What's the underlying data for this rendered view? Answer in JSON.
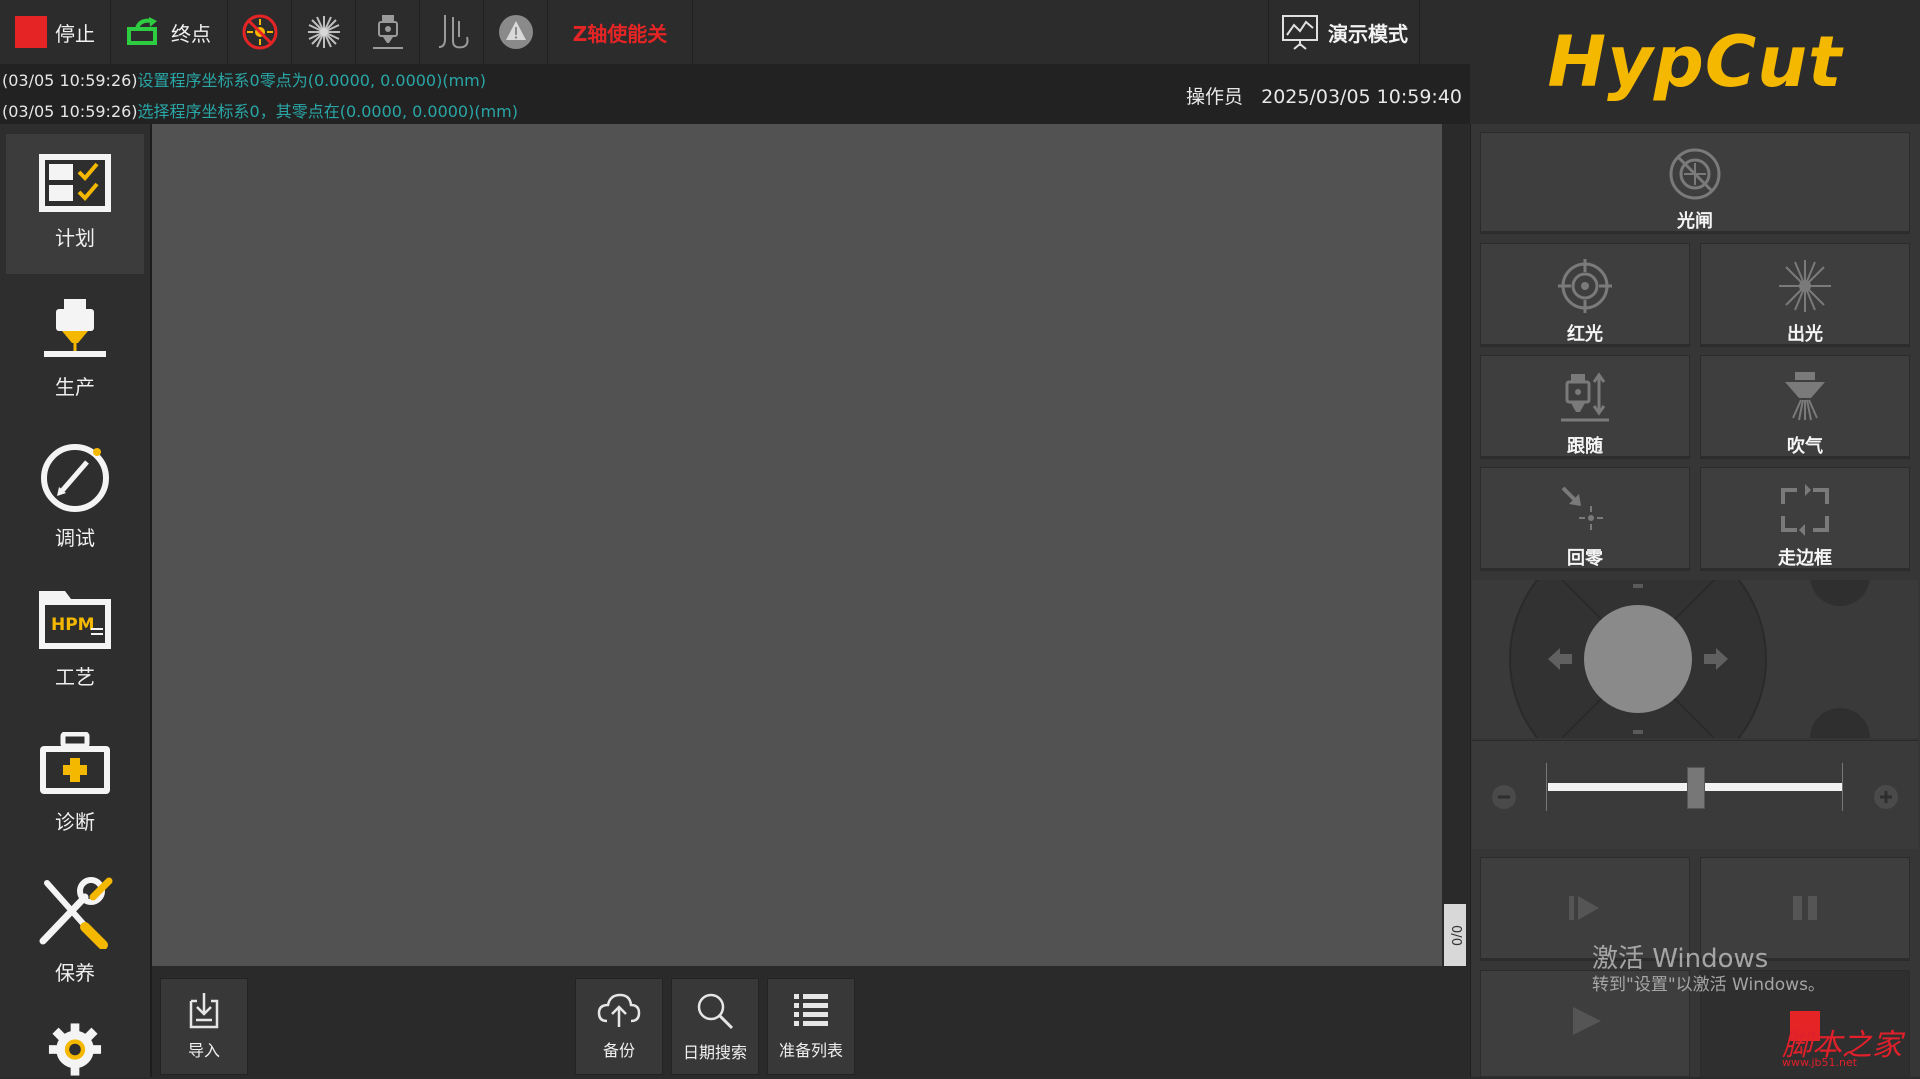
{
  "toolbar": {
    "stop_label": "停止",
    "end_label": "终点",
    "z_axis_label": "Z轴使能关",
    "demo_label": "演示模式"
  },
  "log": {
    "lines": [
      {
        "time": "(03/05 10:59:26)",
        "message": "设置程序坐标系0零点为(0.0000, 0.0000)(mm)"
      },
      {
        "time": "(03/05 10:59:26)",
        "message": "选择程序坐标系0，其零点在(0.0000, 0.0000)(mm)"
      }
    ],
    "operator": "操作员",
    "datetime": "2025/03/05 10:59:40"
  },
  "sidebar": {
    "items": [
      {
        "label": "计划",
        "icon": "plan-icon"
      },
      {
        "label": "生产",
        "icon": "production-icon"
      },
      {
        "label": "调试",
        "icon": "debug-icon"
      },
      {
        "label": "工艺",
        "icon": "process-icon"
      },
      {
        "label": "诊断",
        "icon": "diagnosis-icon"
      },
      {
        "label": "保养",
        "icon": "maintenance-icon"
      }
    ],
    "hpm_text": "HPM"
  },
  "canvas": {
    "counter": "0/0"
  },
  "bottombar": {
    "import_label": "导入",
    "backup_label": "备份",
    "date_search_label": "日期搜索",
    "prep_list_label": "准备列表"
  },
  "right": {
    "logo": "HypCut",
    "shutter_label": "光闸",
    "red_light_label": "红光",
    "laser_out_label": "出光",
    "follow_label": "跟随",
    "blow_label": "吹气",
    "home_label": "回零",
    "frame_label": "走边框",
    "speed_fraction": 0.5
  },
  "watermark": {
    "line1": "激活 Windows",
    "line2": "转到\"设置\"以激活 Windows。",
    "site": "脚本之家",
    "url": "www.jb51.net"
  },
  "colors": {
    "stop_red": "#e52525",
    "end_green": "#2ecc40",
    "z_axis_red": "#e52525",
    "log_teal": "#2aa6a6",
    "logo_yellow": "#f5b800"
  }
}
